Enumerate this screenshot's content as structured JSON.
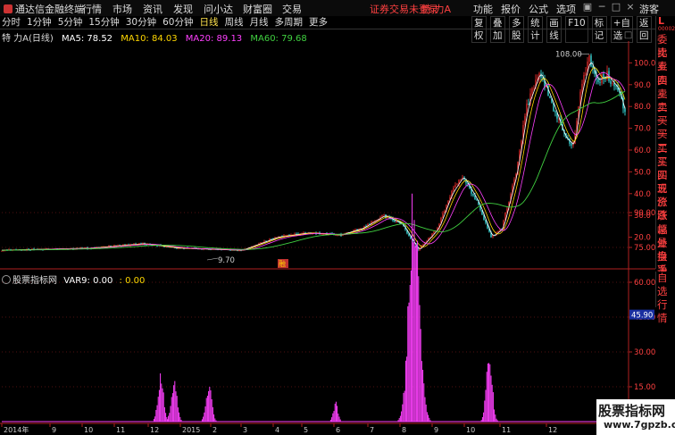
{
  "titlebar": {
    "app_name": "通达信金融终端",
    "menu": [
      "行情",
      "市场",
      "资讯",
      "发现",
      "问小达",
      "财富圈",
      "交易"
    ],
    "login_warning": "证券交易未登录",
    "stock": "特 力A",
    "right_menu": [
      "功能",
      "报价",
      "公式",
      "选项"
    ],
    "guest": "游客"
  },
  "toolbar": {
    "periods": [
      "分时",
      "1分钟",
      "5分钟",
      "15分钟",
      "30分钟",
      "60分钟",
      "日线",
      "周线",
      "月线",
      "多周期",
      "更多"
    ],
    "active_period": "日线",
    "tools": [
      "复权",
      "叠加",
      "多股",
      "统计",
      "画线",
      "F10",
      "标记",
      "+自选",
      "返回"
    ]
  },
  "chart_info": {
    "name": "特 力A",
    "period": "(日线)",
    "ma5": "MA5: 78.52",
    "ma10": "MA10: 84.03",
    "ma20": "MA20: 89.13",
    "ma60": "MA60: 79.68",
    "colors": {
      "ma5": "#ffffff",
      "ma10": "#ffd700",
      "ma20": "#ff40ff",
      "ma60": "#40d040",
      "up": "#ff3030",
      "down": "#40ffff"
    }
  },
  "side_quote": {
    "label": "L",
    "code": "000025",
    "items": [
      "委比",
      "卖五",
      "卖四",
      "卖三",
      "卖二",
      "卖一",
      "买一",
      "买二",
      "买三",
      "买四",
      "买五",
      "现价",
      "涨跌",
      "涨幅",
      "总量",
      "外盘",
      "换手",
      "净资",
      "收益"
    ],
    "bottom_items": [
      "自选",
      "行情"
    ]
  },
  "indicator": {
    "name": "股票指标网",
    "var9": "VAR9: 0.00",
    "var9_2": ": 0.00",
    "color": "#ff40ff"
  },
  "price_axis": [
    "100.0",
    "90.0",
    "80.0",
    "70.0",
    "60.0",
    "50.0",
    "40.0",
    "30.0",
    "20.0"
  ],
  "indicator_axis": [
    "90.00",
    "75.00",
    "60.00",
    "45.00",
    "30.00",
    "15.00"
  ],
  "indicator_current": "45.90",
  "annotations": {
    "high": "108.00",
    "low": "9.70",
    "marker": "融"
  },
  "time_axis": [
    "2014年",
    "9",
    "10",
    "11",
    "12",
    "2015",
    "2",
    "3",
    "4",
    "5",
    "6",
    "7",
    "8",
    "9",
    "10",
    "11",
    "12"
  ],
  "watermark": {
    "line1": "股票指标网",
    "line2": "www.7gpzb.com"
  }
}
